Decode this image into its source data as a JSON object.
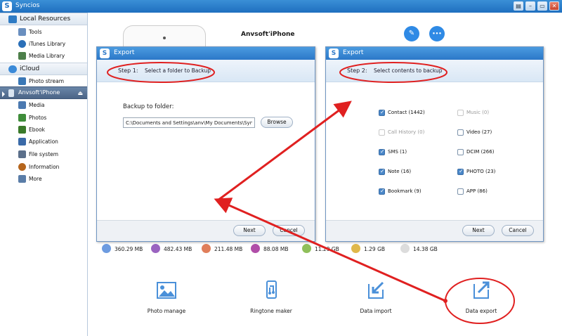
{
  "window": {
    "title": "Syncios",
    "controls": [
      "▤",
      "–",
      "▭",
      "✕"
    ]
  },
  "sidebar": {
    "local_resources": {
      "label": "Local Resources",
      "items": [
        {
          "label": "Tools",
          "color": "#6a8fbf"
        },
        {
          "label": "iTunes Library",
          "color": "#2a6fb8"
        },
        {
          "label": "Media Library",
          "color": "#4d7f4a"
        }
      ]
    },
    "icloud": {
      "label": "iCloud",
      "items": [
        {
          "label": "Photo stream",
          "color": "#3b78b6"
        }
      ]
    },
    "device": {
      "label": "Anvsoft'iPhone",
      "eject": "⏏",
      "items": [
        {
          "label": "Media",
          "color": "#4b79b0"
        },
        {
          "label": "Photos",
          "color": "#3f8d3a"
        },
        {
          "label": "Ebook",
          "color": "#3a7a2a"
        },
        {
          "label": "Application",
          "color": "#3a6aa8"
        },
        {
          "label": "File system",
          "color": "#5b6f8a"
        },
        {
          "label": "Information",
          "color": "#b5651d"
        },
        {
          "label": "More",
          "color": "#5a7da8"
        }
      ]
    }
  },
  "main": {
    "device_name": "Anvsoft'iPhone",
    "edit_icon": "✎",
    "more_icon": "•••",
    "storage": [
      {
        "value": "360.29 MB",
        "color": "#6d9be0"
      },
      {
        "value": "482.43 MB",
        "color": "#9a63c0"
      },
      {
        "value": "211.48 MB",
        "color": "#e07e5a"
      },
      {
        "value": "88.08 MB",
        "color": "#b04ea8"
      },
      {
        "value": "11.29 GB",
        "color": "#8fbf5a"
      },
      {
        "value": "1.29 GB",
        "color": "#e0b84a"
      },
      {
        "value": "14.38 GB",
        "color": "#dcdcdc"
      }
    ],
    "tools": [
      {
        "label": "Photo manage"
      },
      {
        "label": "Ringtone maker"
      },
      {
        "label": "Data import"
      },
      {
        "label": "Data export"
      }
    ]
  },
  "export_dialog_1": {
    "title": "Export",
    "step_label": "Step 1:",
    "step_text": "Select a folder to Backup",
    "field_label": "Backup to folder:",
    "path_value": "C:\\Documents and Settings\\anv\\My Documents\\Syncios",
    "browse_label": "Browse",
    "next_label": "Next",
    "cancel_label": "Cancel"
  },
  "export_dialog_2": {
    "title": "Export",
    "step_label": "Step 2:",
    "step_text": "Select contents to backup",
    "options": [
      {
        "label": "Contact (1442)",
        "checked": true,
        "enabled": true
      },
      {
        "label": "Music (0)",
        "checked": false,
        "enabled": false
      },
      {
        "label": "Call History (0)",
        "checked": false,
        "enabled": false
      },
      {
        "label": "Video (27)",
        "checked": false,
        "enabled": true
      },
      {
        "label": "SMS (1)",
        "checked": true,
        "enabled": true
      },
      {
        "label": "DCIM (266)",
        "checked": false,
        "enabled": true
      },
      {
        "label": "Note (16)",
        "checked": true,
        "enabled": true
      },
      {
        "label": "PHOTO (23)",
        "checked": true,
        "enabled": true
      },
      {
        "label": "Bookmark (9)",
        "checked": true,
        "enabled": true
      },
      {
        "label": "APP (86)",
        "checked": false,
        "enabled": true
      }
    ],
    "next_label": "Next",
    "cancel_label": "Cancel"
  },
  "annotation_color": "#e02020"
}
